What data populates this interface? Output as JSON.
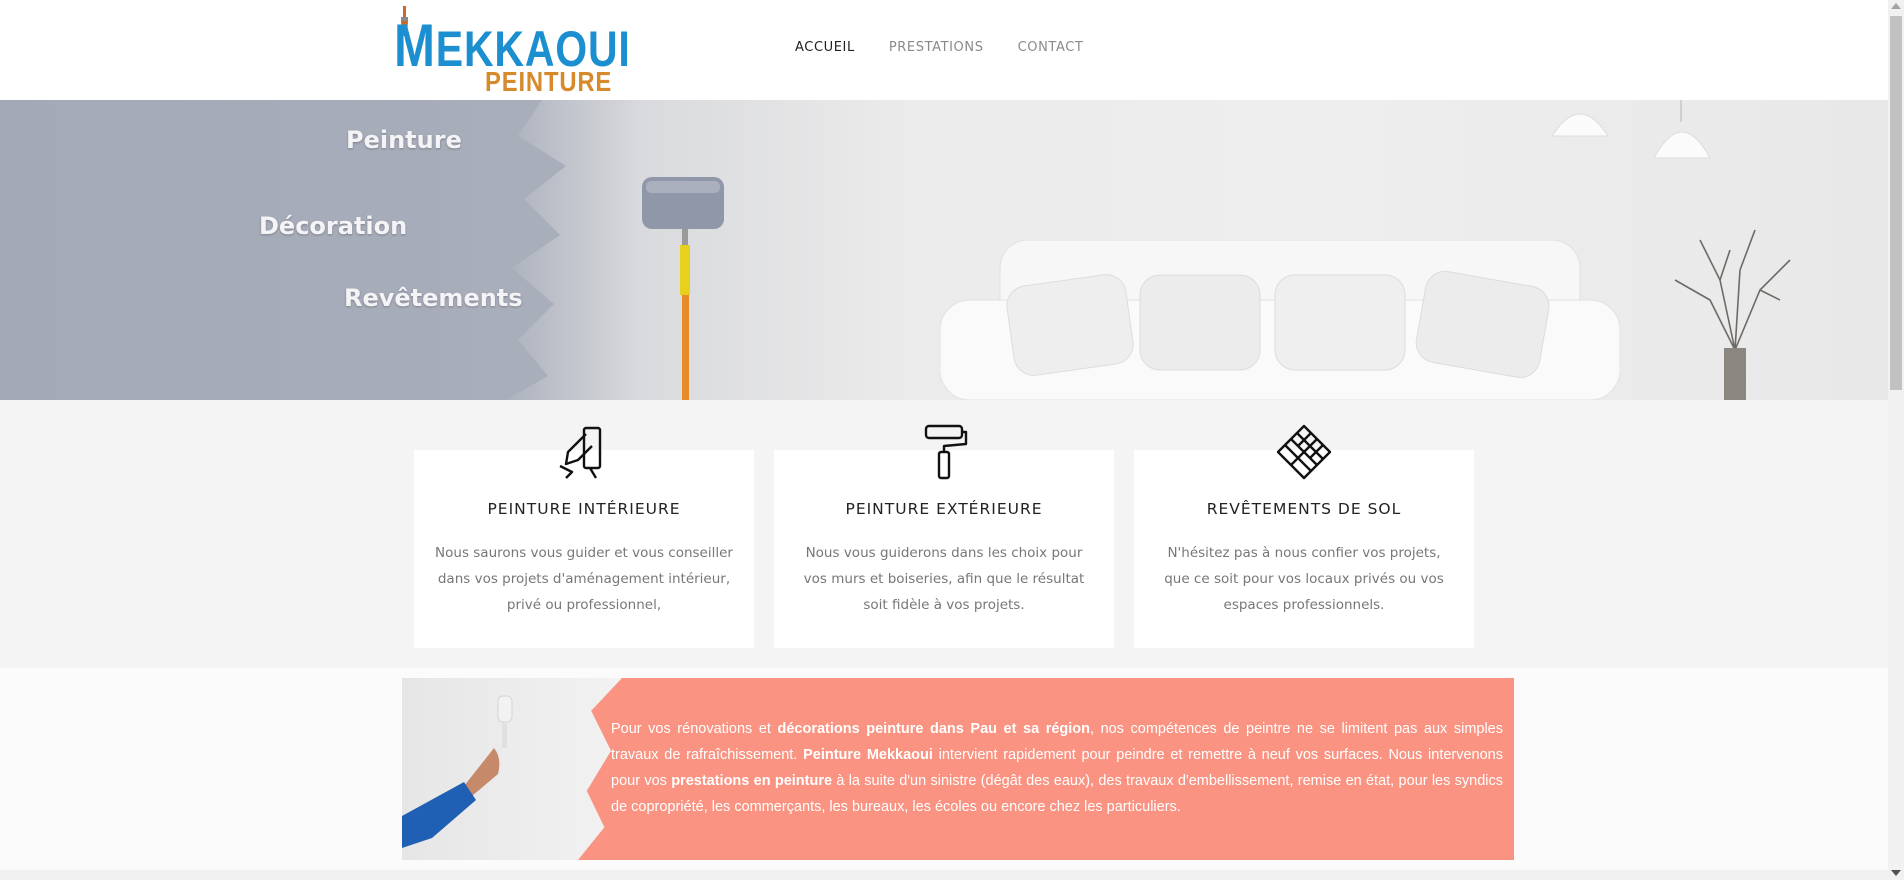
{
  "logo": {
    "main_first": "M",
    "main_rest": "EKKAOUI",
    "sub": "PEINTURE",
    "colors": {
      "blue": "#1b8fd0",
      "orange": "#d68a2c"
    }
  },
  "nav": {
    "items": [
      {
        "label": "ACCUEIL",
        "active": true
      },
      {
        "label": "PRESTATIONS",
        "active": false
      },
      {
        "label": "CONTACT",
        "active": false
      }
    ]
  },
  "hero": {
    "lines": [
      "Peinture",
      "Décoration",
      "Revêtements"
    ]
  },
  "services": [
    {
      "icon": "paint-brushes-icon",
      "title": "PEINTURE INTÉRIEURE",
      "text": "Nous saurons vous guider et vous conseiller dans vos projets d'aménagement intérieur, privé ou professionnel,"
    },
    {
      "icon": "paint-roller-icon",
      "title": "PEINTURE EXTÉRIEURE",
      "text": "Nous vous guiderons dans les choix pour vos murs et boiseries, afin que le résultat soit fidèle à vos projets."
    },
    {
      "icon": "parquet-floor-icon",
      "title": "REVÊTEMENTS DE SOL",
      "text": "N'hésitez pas à nous confier vos projets, que ce soit pour vos locaux privés ou vos espaces professionnels."
    }
  ],
  "promo": {
    "segments": [
      {
        "text": "Pour vos rénovations et ",
        "bold": false
      },
      {
        "text": "décorations peinture dans Pau et sa région",
        "bold": true
      },
      {
        "text": ", nos compétences de peintre ne se limitent pas aux simples travaux de rafraîchissement. ",
        "bold": false
      },
      {
        "text": "Peinture Mekkaoui",
        "bold": true
      },
      {
        "text": " intervient rapidement pour peindre et remettre à neuf vos surfaces. Nous intervenons pour vos ",
        "bold": false
      },
      {
        "text": "prestations en peinture",
        "bold": true
      },
      {
        "text": " à la suite d'un sinistre (dégât des eaux), des travaux d'embellissement, remise en état, pour les syndics de copropriété, les commerçants, les bureaux, les écoles ou encore chez les particuliers.",
        "bold": false
      }
    ],
    "background": "#fa9381"
  }
}
